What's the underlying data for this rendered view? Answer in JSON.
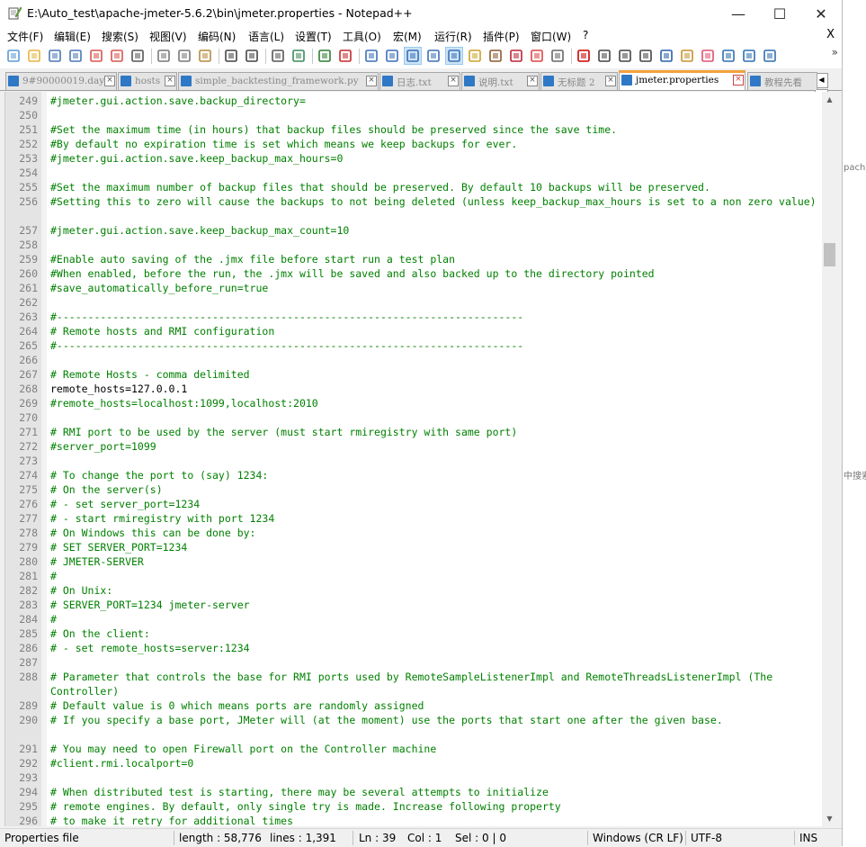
{
  "window": {
    "title": "E:\\Auto_test\\apache-jmeter-5.6.2\\bin\\jmeter.properties - Notepad++",
    "controls": {
      "minimize": "—",
      "maximize": "☐",
      "close": "✕"
    }
  },
  "menu": {
    "items": [
      "文件(F)",
      "编辑(E)",
      "搜索(S)",
      "视图(V)",
      "编码(N)",
      "语言(L)",
      "设置(T)",
      "工具(O)",
      "宏(M)",
      "运行(R)",
      "插件(P)",
      "窗口(W)",
      "?"
    ],
    "close": "X"
  },
  "toolbar": {
    "icons": [
      "new-file-icon",
      "open-file-icon",
      "save-icon",
      "save-all-icon",
      "close-icon",
      "close-all-icon",
      "print-icon",
      "cut-icon",
      "copy-icon",
      "paste-icon",
      "undo-icon",
      "redo-icon",
      "find-icon",
      "replace-icon",
      "zoom-in-icon",
      "zoom-out-icon",
      "sync-vertical-icon",
      "sync-horizontal-icon",
      "word-wrap-icon",
      "show-all-chars-icon",
      "indent-guide-icon",
      "udl-icon",
      "doc-map-icon",
      "function-list-icon",
      "folder-workspace-icon",
      "monitor-icon",
      "record-macro-icon",
      "stop-macro-icon",
      "play-macro-icon",
      "run-macro-multiple-icon",
      "save-macro-icon",
      "spell-check-icon",
      "favorite-icon",
      "download-icon",
      "plugin-a-icon",
      "plugin-b-icon"
    ],
    "overflow": "»"
  },
  "tabs": [
    {
      "label": "9#90000019.day",
      "active": false
    },
    {
      "label": "hosts",
      "active": false
    },
    {
      "label": "simple_backtesting_framework.py",
      "active": false
    },
    {
      "label": "日志.txt",
      "active": false
    },
    {
      "label": "说明.txt",
      "active": false
    },
    {
      "label": "无标题 2",
      "active": false
    },
    {
      "label": "jmeter.properties",
      "active": true
    },
    {
      "label": "教程先看",
      "active": false
    }
  ],
  "editor": {
    "lines": [
      {
        "n": "249",
        "t": "#jmeter.gui.action.save.backup_directory="
      },
      {
        "n": "250",
        "t": ""
      },
      {
        "n": "251",
        "t": "#Set the maximum time (in hours) that backup files should be preserved since the save time."
      },
      {
        "n": "252",
        "t": "#By default no expiration time is set which means we keep backups for ever."
      },
      {
        "n": "253",
        "t": "#jmeter.gui.action.save.keep_backup_max_hours=0"
      },
      {
        "n": "254",
        "t": ""
      },
      {
        "n": "255",
        "t": "#Set the maximum number of backup files that should be preserved. By default 10 backups will be preserved."
      },
      {
        "n": "256",
        "t": "#Setting this to zero will cause the backups to not being deleted (unless keep_backup_max_hours is set to a non zero value)",
        "wrap": true
      },
      {
        "n": "257",
        "t": "#jmeter.gui.action.save.keep_backup_max_count=10"
      },
      {
        "n": "258",
        "t": ""
      },
      {
        "n": "259",
        "t": "#Enable auto saving of the .jmx file before start run a test plan"
      },
      {
        "n": "260",
        "t": "#When enabled, before the run, the .jmx will be saved and also backed up to the directory pointed"
      },
      {
        "n": "261",
        "t": "#save_automatically_before_run=true"
      },
      {
        "n": "262",
        "t": ""
      },
      {
        "n": "263",
        "t": "#---------------------------------------------------------------------------"
      },
      {
        "n": "264",
        "t": "# Remote hosts and RMI configuration"
      },
      {
        "n": "265",
        "t": "#---------------------------------------------------------------------------"
      },
      {
        "n": "266",
        "t": ""
      },
      {
        "n": "267",
        "t": "# Remote Hosts - comma delimited"
      },
      {
        "n": "268",
        "t": "remote_hosts=127.0.0.1",
        "plain": true
      },
      {
        "n": "269",
        "t": "#remote_hosts=localhost:1099,localhost:2010"
      },
      {
        "n": "270",
        "t": ""
      },
      {
        "n": "271",
        "t": "# RMI port to be used by the server (must start rmiregistry with same port)"
      },
      {
        "n": "272",
        "t": "#server_port=1099"
      },
      {
        "n": "273",
        "t": ""
      },
      {
        "n": "274",
        "t": "# To change the port to (say) 1234:"
      },
      {
        "n": "275",
        "t": "# On the server(s)"
      },
      {
        "n": "276",
        "t": "# - set server_port=1234"
      },
      {
        "n": "277",
        "t": "# - start rmiregistry with port 1234"
      },
      {
        "n": "278",
        "t": "# On Windows this can be done by:"
      },
      {
        "n": "279",
        "t": "# SET SERVER_PORT=1234"
      },
      {
        "n": "280",
        "t": "# JMETER-SERVER"
      },
      {
        "n": "281",
        "t": "#"
      },
      {
        "n": "282",
        "t": "# On Unix:"
      },
      {
        "n": "283",
        "t": "# SERVER_PORT=1234 jmeter-server"
      },
      {
        "n": "284",
        "t": "#"
      },
      {
        "n": "285",
        "t": "# On the client:"
      },
      {
        "n": "286",
        "t": "# - set remote_hosts=server:1234"
      },
      {
        "n": "287",
        "t": ""
      },
      {
        "n": "288",
        "t": "# Parameter that controls the base for RMI ports used by RemoteSampleListenerImpl and RemoteThreadsListenerImpl (The Controller)",
        "wrap": true
      },
      {
        "n": "289",
        "t": "# Default value is 0 which means ports are randomly assigned"
      },
      {
        "n": "290",
        "t": "# If you specify a base port, JMeter will (at the moment) use the ports that start one after the given base.",
        "wrap": true
      },
      {
        "n": "291",
        "t": "# You may need to open Firewall port on the Controller machine"
      },
      {
        "n": "292",
        "t": "#client.rmi.localport=0"
      },
      {
        "n": "293",
        "t": ""
      },
      {
        "n": "294",
        "t": "# When distributed test is starting, there may be several attempts to initialize"
      },
      {
        "n": "295",
        "t": "# remote engines. By default, only single try is made. Increase following property"
      },
      {
        "n": "296",
        "t": "# to make it retry for additional times"
      }
    ]
  },
  "scrollbar": {
    "position": 0.2
  },
  "status": {
    "file_type": "Properties file",
    "length": "length : 58,776",
    "lines": "lines : 1,391",
    "ln": "Ln : 39",
    "col": "Col : 1",
    "sel": "Sel : 0 | 0",
    "eol": "Windows (CR LF)",
    "encoding": "UTF-8",
    "mode": "INS"
  },
  "background": {
    "frag1": "pach",
    "frag2": "中搜索"
  }
}
